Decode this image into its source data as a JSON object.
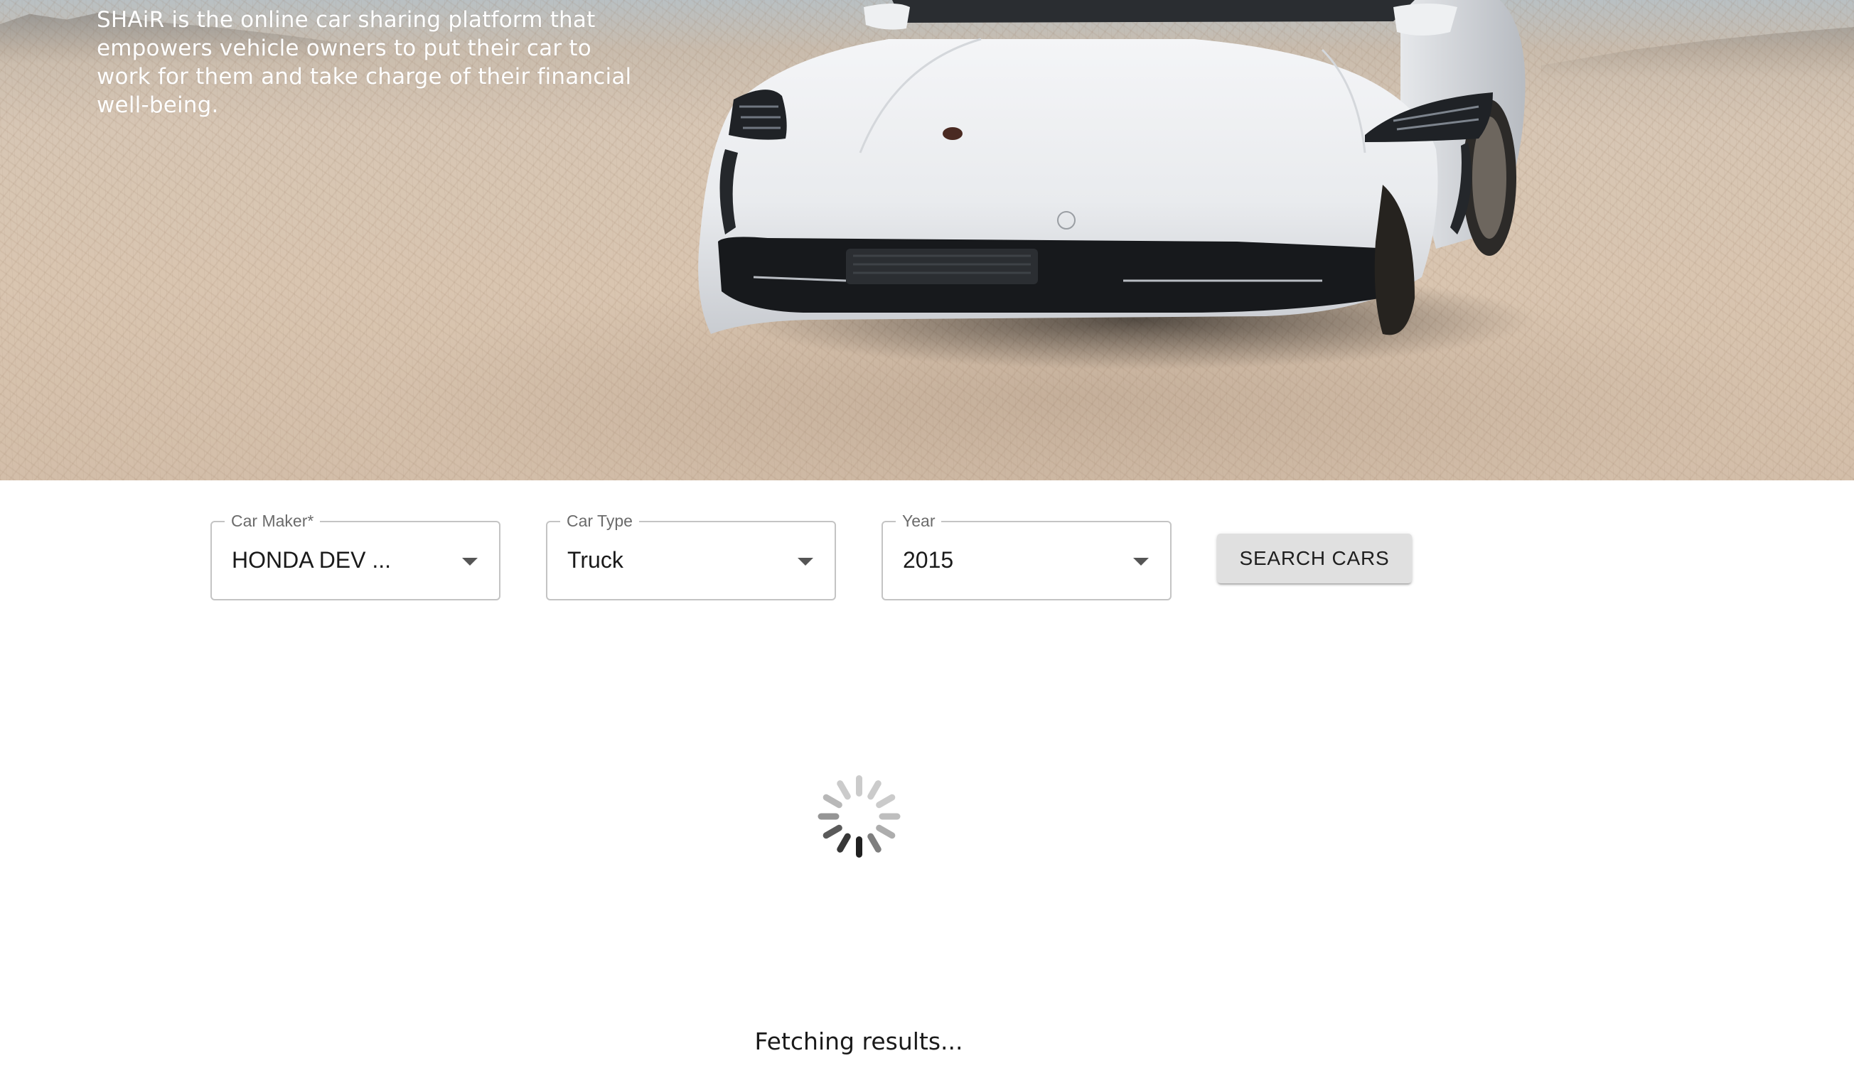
{
  "hero": {
    "description": "SHAiR is the online car sharing platform that empowers vehicle owners to put their car to work for them and take charge of their financial well-being."
  },
  "search": {
    "car_maker": {
      "label": "Car Maker",
      "required_mark": "*",
      "value": "HONDA DEV  ..."
    },
    "car_type": {
      "label": "Car Type",
      "value": "Truck"
    },
    "year": {
      "label": "Year",
      "value": "2015"
    },
    "button_label": "SEARCH CARS"
  },
  "loading": {
    "status": "Fetching results..."
  }
}
